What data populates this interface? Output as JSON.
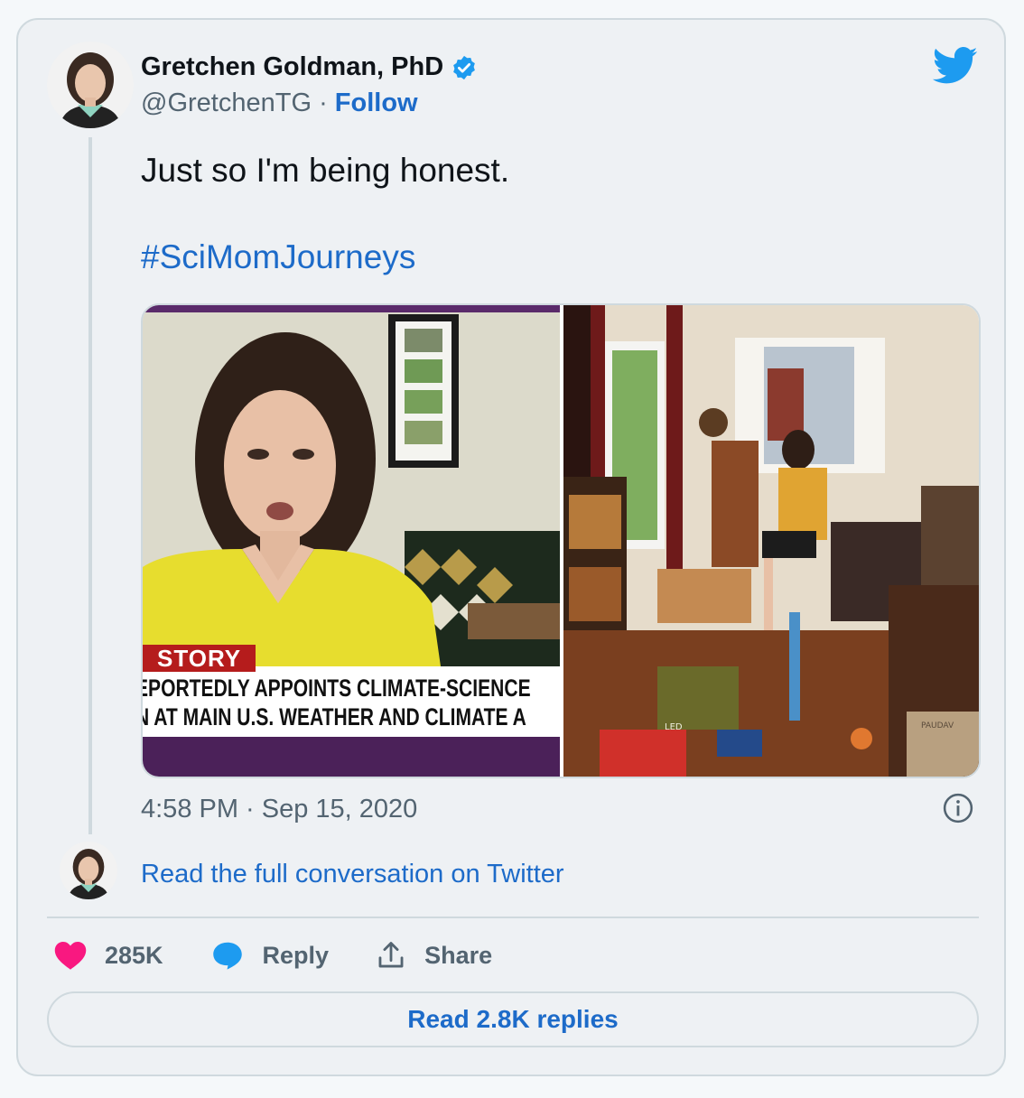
{
  "author": {
    "name": "Gretchen Goldman, PhD",
    "handle": "@GretchenTG",
    "separator": "·",
    "follow_label": "Follow",
    "verified_icon": "verified-badge-icon"
  },
  "brand_icon": "twitter-bird-icon",
  "tweet": {
    "text": "Just so I'm being honest.",
    "hashtag": "#SciMomJourneys",
    "timestamp": "4:58 PM · Sep 15, 2020"
  },
  "media": {
    "left_image": {
      "chyron_tag": "STORY",
      "chyron_line1": "EPORTEDLY APPOINTS CLIMATE-SCIENCE",
      "chyron_line2": "N AT MAIN U.S. WEATHER AND CLIMATE A"
    },
    "right_image": {
      "box_label": "LED",
      "box_brand": "PAUDAV"
    }
  },
  "conversation_link": "Read the full conversation on Twitter",
  "actions": {
    "likes": "285K",
    "reply_label": "Reply",
    "share_label": "Share"
  },
  "replies_button": "Read 2.8K replies",
  "colors": {
    "link": "#1d6bc9",
    "heart": "#f91880",
    "twitter_blue": "#1d9bf0",
    "border": "#cfd9de"
  }
}
